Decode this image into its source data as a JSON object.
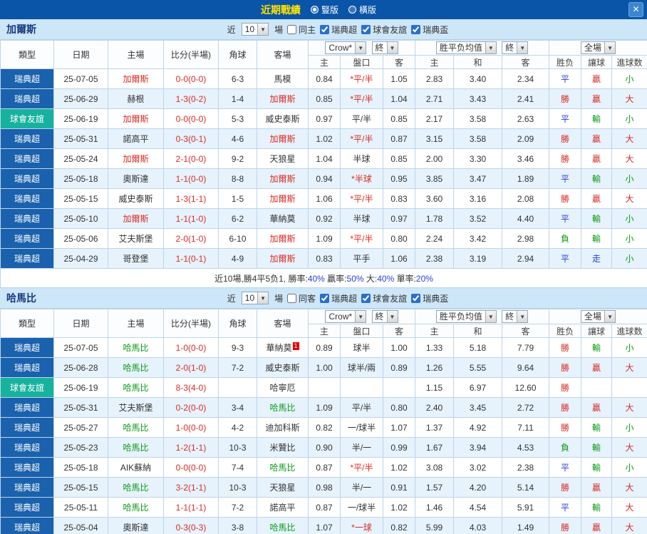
{
  "topbar": {
    "title": "近期戰績",
    "radio_vertical": "豎版",
    "radio_horizontal": "橫版",
    "close": "✕"
  },
  "table_headers": {
    "type": "類型",
    "date": "日期",
    "home": "主場",
    "score": "比分(半場)",
    "corners": "角球",
    "away": "客場",
    "bookmaker_select": "Crow*",
    "final_select": "終",
    "asia_home": "主",
    "asia_handicap": "盤口",
    "asia_away": "客",
    "euro_select": "胜平负均值",
    "euro_home": "主",
    "euro_draw": "和",
    "euro_away": "客",
    "scope_select": "全場",
    "res_wdl": "胜负",
    "res_handicap": "讓球",
    "res_goals": "進球数"
  },
  "sections": [
    {
      "team": "加爾斯",
      "filter": {
        "prefix": "近",
        "count": "10",
        "suffix": "場",
        "same_label": "同主",
        "same_checked": false,
        "leagues": [
          {
            "label": "瑞典超",
            "checked": true
          },
          {
            "label": "球會友誼",
            "checked": true
          },
          {
            "label": "瑞典盃",
            "checked": true
          }
        ]
      },
      "rows": [
        {
          "league": "瑞典超",
          "type": "super",
          "date": "25-07-05",
          "home": "加爾斯",
          "home_c": "red",
          "score": "0-0(0-0)",
          "corners": "6-3",
          "away": "馬模",
          "away_c": "black",
          "ah": "0.84",
          "hc": "*平/半",
          "hc_c": "red",
          "aa": "1.05",
          "eh": "2.83",
          "ed": "3.40",
          "ea": "2.34",
          "wdl": "平",
          "wdl_c": "blue",
          "let": "贏",
          "let_c": "red",
          "goal": "小",
          "goal_c": "green"
        },
        {
          "league": "瑞典超",
          "type": "super",
          "date": "25-06-29",
          "home": "赫根",
          "home_c": "black",
          "score": "1-3(0-2)",
          "corners": "1-4",
          "away": "加爾斯",
          "away_c": "red",
          "ah": "0.85",
          "hc": "*平/半",
          "hc_c": "red",
          "aa": "1.04",
          "eh": "2.71",
          "ed": "3.43",
          "ea": "2.41",
          "wdl": "勝",
          "wdl_c": "red",
          "let": "贏",
          "let_c": "red",
          "goal": "大",
          "goal_c": "red"
        },
        {
          "league": "球會友誼",
          "type": "friendly",
          "date": "25-06-19",
          "home": "加爾斯",
          "home_c": "red",
          "score": "0-0(0-0)",
          "corners": "5-3",
          "away": "威史泰斯",
          "away_c": "black",
          "ah": "0.97",
          "hc": "平/半",
          "hc_c": "black",
          "aa": "0.85",
          "eh": "2.17",
          "ed": "3.58",
          "ea": "2.63",
          "wdl": "平",
          "wdl_c": "blue",
          "let": "輸",
          "let_c": "green",
          "goal": "小",
          "goal_c": "green"
        },
        {
          "league": "瑞典超",
          "type": "super",
          "date": "25-05-31",
          "home": "諾高平",
          "home_c": "black",
          "score": "0-3(0-1)",
          "corners": "4-6",
          "away": "加爾斯",
          "away_c": "red",
          "ah": "1.02",
          "hc": "*平/半",
          "hc_c": "red",
          "aa": "0.87",
          "eh": "3.15",
          "ed": "3.58",
          "ea": "2.09",
          "wdl": "勝",
          "wdl_c": "red",
          "let": "贏",
          "let_c": "red",
          "goal": "大",
          "goal_c": "red"
        },
        {
          "league": "瑞典超",
          "type": "super",
          "date": "25-05-24",
          "home": "加爾斯",
          "home_c": "red",
          "score": "2-1(0-0)",
          "corners": "9-2",
          "away": "天狼星",
          "away_c": "black",
          "ah": "1.04",
          "hc": "半球",
          "hc_c": "black",
          "aa": "0.85",
          "eh": "2.00",
          "ed": "3.30",
          "ea": "3.46",
          "wdl": "勝",
          "wdl_c": "red",
          "let": "贏",
          "let_c": "red",
          "goal": "大",
          "goal_c": "red"
        },
        {
          "league": "瑞典超",
          "type": "super",
          "date": "25-05-18",
          "home": "奧斯達",
          "home_c": "black",
          "score": "1-1(0-0)",
          "corners": "8-8",
          "away": "加爾斯",
          "away_c": "red",
          "ah": "0.94",
          "hc": "*半球",
          "hc_c": "red",
          "aa": "0.95",
          "eh": "3.85",
          "ed": "3.47",
          "ea": "1.89",
          "wdl": "平",
          "wdl_c": "blue",
          "let": "輸",
          "let_c": "green",
          "goal": "小",
          "goal_c": "green"
        },
        {
          "league": "瑞典超",
          "type": "super",
          "date": "25-05-15",
          "home": "威史泰斯",
          "home_c": "black",
          "score": "1-3(1-1)",
          "corners": "1-5",
          "away": "加爾斯",
          "away_c": "red",
          "ah": "1.06",
          "hc": "*平/半",
          "hc_c": "red",
          "aa": "0.83",
          "eh": "3.60",
          "ed": "3.16",
          "ea": "2.08",
          "wdl": "勝",
          "wdl_c": "red",
          "let": "贏",
          "let_c": "red",
          "goal": "大",
          "goal_c": "red"
        },
        {
          "league": "瑞典超",
          "type": "super",
          "date": "25-05-10",
          "home": "加爾斯",
          "home_c": "red",
          "score": "1-1(1-0)",
          "corners": "6-2",
          "away": "華納莫",
          "away_c": "black",
          "ah": "0.92",
          "hc": "半球",
          "hc_c": "black",
          "aa": "0.97",
          "eh": "1.78",
          "ed": "3.52",
          "ea": "4.40",
          "wdl": "平",
          "wdl_c": "blue",
          "let": "輸",
          "let_c": "green",
          "goal": "小",
          "goal_c": "green"
        },
        {
          "league": "瑞典超",
          "type": "super",
          "date": "25-05-06",
          "home": "艾夫斯堡",
          "home_c": "black",
          "score": "2-0(1-0)",
          "corners": "6-10",
          "away": "加爾斯",
          "away_c": "red",
          "ah": "1.09",
          "hc": "*平/半",
          "hc_c": "red",
          "aa": "0.80",
          "eh": "2.24",
          "ed": "3.42",
          "ea": "2.98",
          "wdl": "負",
          "wdl_c": "green",
          "let": "輸",
          "let_c": "green",
          "goal": "小",
          "goal_c": "green"
        },
        {
          "league": "瑞典超",
          "type": "super",
          "date": "25-04-29",
          "home": "哥登堡",
          "home_c": "black",
          "score": "1-1(0-1)",
          "corners": "4-9",
          "away": "加爾斯",
          "away_c": "red",
          "ah": "0.83",
          "hc": "平手",
          "hc_c": "black",
          "aa": "1.06",
          "eh": "2.38",
          "ed": "3.19",
          "ea": "2.94",
          "wdl": "平",
          "wdl_c": "blue",
          "let": "走",
          "let_c": "blue",
          "goal": "小",
          "goal_c": "green"
        }
      ],
      "summary": [
        {
          "t": "近10場,勝4平5负1, 勝率:",
          "c": "black"
        },
        {
          "t": "40%",
          "c": "blue"
        },
        {
          "t": " 贏率:",
          "c": "black"
        },
        {
          "t": "50%",
          "c": "blue"
        },
        {
          "t": " 大:",
          "c": "black"
        },
        {
          "t": "40%",
          "c": "blue"
        },
        {
          "t": " 單率:",
          "c": "black"
        },
        {
          "t": "20%",
          "c": "blue"
        }
      ]
    },
    {
      "team": "哈馬比",
      "filter": {
        "prefix": "近",
        "count": "10",
        "suffix": "場",
        "same_label": "同客",
        "same_checked": false,
        "leagues": [
          {
            "label": "瑞典超",
            "checked": true
          },
          {
            "label": "球會友誼",
            "checked": true
          },
          {
            "label": "瑞典盃",
            "checked": true
          }
        ]
      },
      "rows": [
        {
          "league": "瑞典超",
          "type": "super",
          "date": "25-07-05",
          "home": "哈馬比",
          "home_c": "green",
          "score": "1-0(0-0)",
          "corners": "9-3",
          "away": "華納莫",
          "away_c": "black",
          "away_sup": "1",
          "ah": "0.89",
          "hc": "球半",
          "hc_c": "black",
          "aa": "1.00",
          "eh": "1.33",
          "ed": "5.18",
          "ea": "7.79",
          "wdl": "勝",
          "wdl_c": "red",
          "let": "輸",
          "let_c": "green",
          "goal": "小",
          "goal_c": "green"
        },
        {
          "league": "瑞典超",
          "type": "super",
          "date": "25-06-28",
          "home": "哈馬比",
          "home_c": "green",
          "score": "2-0(1-0)",
          "corners": "7-2",
          "away": "威史泰斯",
          "away_c": "black",
          "ah": "1.00",
          "hc": "球半/兩",
          "hc_c": "black",
          "aa": "0.89",
          "eh": "1.26",
          "ed": "5.55",
          "ea": "9.64",
          "wdl": "勝",
          "wdl_c": "red",
          "let": "贏",
          "let_c": "red",
          "goal": "大",
          "goal_c": "red"
        },
        {
          "league": "球會友誼",
          "type": "friendly",
          "date": "25-06-19",
          "home": "哈馬比",
          "home_c": "green",
          "score": "8-3(4-0)",
          "corners": "",
          "away": "哈寧厄",
          "away_c": "black",
          "ah": "",
          "hc": "",
          "hc_c": "black",
          "aa": "",
          "eh": "1.15",
          "ed": "6.97",
          "ea": "12.60",
          "wdl": "勝",
          "wdl_c": "red",
          "let": "",
          "let_c": "black",
          "goal": "",
          "goal_c": "black"
        },
        {
          "league": "瑞典超",
          "type": "super",
          "date": "25-05-31",
          "home": "艾夫斯堡",
          "home_c": "black",
          "score": "0-2(0-0)",
          "corners": "3-4",
          "away": "哈馬比",
          "away_c": "green",
          "ah": "1.09",
          "hc": "平/半",
          "hc_c": "black",
          "aa": "0.80",
          "eh": "2.40",
          "ed": "3.45",
          "ea": "2.72",
          "wdl": "勝",
          "wdl_c": "red",
          "let": "贏",
          "let_c": "red",
          "goal": "大",
          "goal_c": "red"
        },
        {
          "league": "瑞典超",
          "type": "super",
          "date": "25-05-27",
          "home": "哈馬比",
          "home_c": "green",
          "score": "1-0(0-0)",
          "corners": "4-2",
          "away": "迪加科斯",
          "away_c": "black",
          "ah": "0.82",
          "hc": "一/球半",
          "hc_c": "black",
          "aa": "1.07",
          "eh": "1.37",
          "ed": "4.92",
          "ea": "7.11",
          "wdl": "勝",
          "wdl_c": "red",
          "let": "輸",
          "let_c": "green",
          "goal": "小",
          "goal_c": "green"
        },
        {
          "league": "瑞典超",
          "type": "super",
          "date": "25-05-23",
          "home": "哈馬比",
          "home_c": "green",
          "score": "1-2(1-1)",
          "corners": "10-3",
          "away": "米贊比",
          "away_c": "black",
          "ah": "0.90",
          "hc": "半/一",
          "hc_c": "black",
          "aa": "0.99",
          "eh": "1.67",
          "ed": "3.94",
          "ea": "4.53",
          "wdl": "負",
          "wdl_c": "green",
          "let": "輸",
          "let_c": "green",
          "goal": "大",
          "goal_c": "red"
        },
        {
          "league": "瑞典超",
          "type": "super",
          "date": "25-05-18",
          "home": "AIK蘇納",
          "home_c": "black",
          "score": "0-0(0-0)",
          "corners": "7-4",
          "away": "哈馬比",
          "away_c": "green",
          "ah": "0.87",
          "hc": "*平/半",
          "hc_c": "red",
          "aa": "1.02",
          "eh": "3.08",
          "ed": "3.02",
          "ea": "2.38",
          "wdl": "平",
          "wdl_c": "blue",
          "let": "輸",
          "let_c": "green",
          "goal": "小",
          "goal_c": "green"
        },
        {
          "league": "瑞典超",
          "type": "super",
          "date": "25-05-15",
          "home": "哈馬比",
          "home_c": "green",
          "score": "3-2(1-1)",
          "corners": "10-3",
          "away": "天狼星",
          "away_c": "black",
          "ah": "0.98",
          "hc": "半/一",
          "hc_c": "black",
          "aa": "0.91",
          "eh": "1.57",
          "ed": "4.20",
          "ea": "5.14",
          "wdl": "勝",
          "wdl_c": "red",
          "let": "贏",
          "let_c": "red",
          "goal": "大",
          "goal_c": "red"
        },
        {
          "league": "瑞典超",
          "type": "super",
          "date": "25-05-11",
          "home": "哈馬比",
          "home_c": "green",
          "score": "1-1(1-1)",
          "corners": "7-2",
          "away": "諾高平",
          "away_c": "black",
          "ah": "0.87",
          "hc": "一/球半",
          "hc_c": "black",
          "aa": "1.02",
          "eh": "1.46",
          "ed": "4.54",
          "ea": "5.91",
          "wdl": "平",
          "wdl_c": "blue",
          "let": "輸",
          "let_c": "green",
          "goal": "大",
          "goal_c": "red"
        },
        {
          "league": "瑞典超",
          "type": "super",
          "date": "25-05-04",
          "home": "奧斯達",
          "home_c": "black",
          "score": "0-3(0-3)",
          "corners": "3-8",
          "away": "哈馬比",
          "away_c": "green",
          "ah": "1.07",
          "hc": "*一球",
          "hc_c": "red",
          "aa": "0.82",
          "eh": "5.99",
          "ed": "4.03",
          "ea": "1.49",
          "wdl": "勝",
          "wdl_c": "red",
          "let": "贏",
          "let_c": "red",
          "goal": "大",
          "goal_c": "red"
        }
      ]
    }
  ]
}
